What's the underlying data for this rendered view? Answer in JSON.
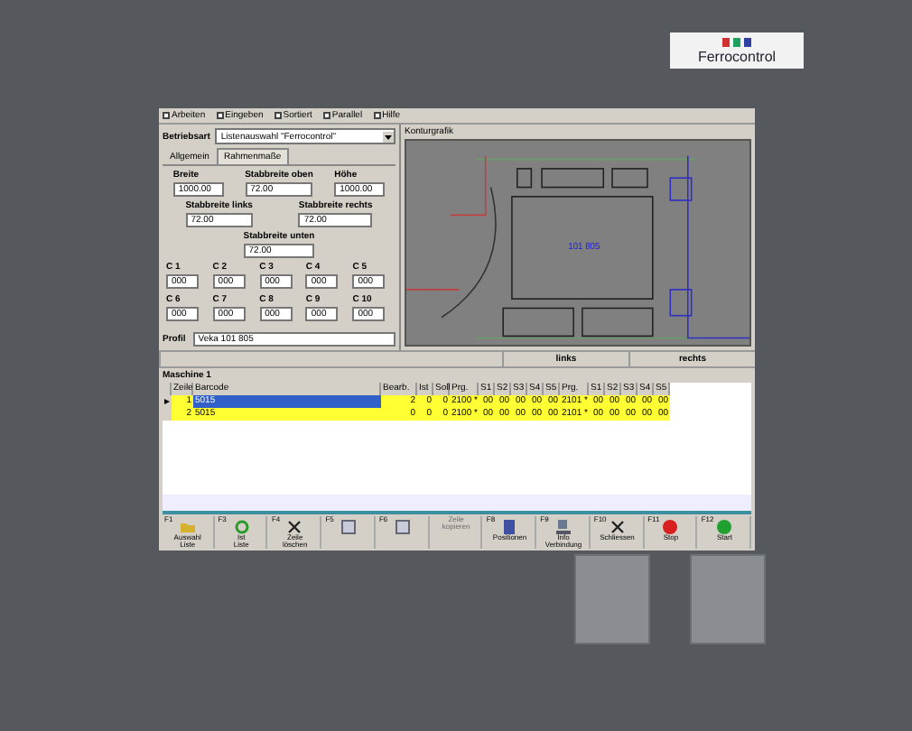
{
  "logo": {
    "text": "Ferrocontrol"
  },
  "menu": [
    {
      "label": "Arbeiten"
    },
    {
      "label": "Eingeben"
    },
    {
      "label": "Sortiert"
    },
    {
      "label": "Parallel"
    },
    {
      "label": "Hilfe"
    }
  ],
  "mode": {
    "label": "Betriebsart",
    "value": "Listenauswahl \"Ferrocontrol\""
  },
  "tabs": [
    {
      "label": "Allgemein",
      "selected": false
    },
    {
      "label": "Rahmenmaße",
      "selected": true
    }
  ],
  "field_rows": [
    [
      {
        "label": "Breite",
        "value": "1000.00"
      },
      {
        "label": "Stabbreite oben",
        "value": "72.00"
      },
      {
        "label": "Höhe",
        "value": "1000.00"
      }
    ],
    [
      {
        "label": "Stabbreite links",
        "value": "72.00"
      },
      {
        "label": "Stabbreite rechts",
        "value": "72.00"
      }
    ],
    [
      {
        "label": "Stabbreite unten",
        "value": "72.00"
      }
    ]
  ],
  "c_fields": [
    {
      "label": "C 1",
      "value": "000"
    },
    {
      "label": "C 2",
      "value": "000"
    },
    {
      "label": "C 3",
      "value": "000"
    },
    {
      "label": "C 4",
      "value": "000"
    },
    {
      "label": "C 5",
      "value": "000"
    },
    {
      "label": "C 6",
      "value": "000"
    },
    {
      "label": "C 7",
      "value": "000"
    },
    {
      "label": "C 8",
      "value": "000"
    },
    {
      "label": "C 9",
      "value": "000"
    },
    {
      "label": "C 10",
      "value": "000"
    }
  ],
  "profile": {
    "label": "Profil",
    "value": "Veka 101 805"
  },
  "contour": {
    "title": "Konturgrafik",
    "label": "101 805"
  },
  "sides": [
    "links",
    "rechts"
  ],
  "machine": {
    "title": "Maschine 1",
    "columns": [
      "Zeile",
      "Barcode",
      "Bearb.",
      "Ist",
      "Soll",
      "Prg.",
      "S1",
      "S2",
      "S3",
      "S4",
      "S5",
      "Prg.",
      "S1",
      "S2",
      "S3",
      "S4",
      "S5"
    ],
    "rows": [
      {
        "selected": true,
        "cells": [
          "1",
          "5015",
          "2",
          "0",
          "0",
          "2100 *",
          "00",
          "00",
          "00",
          "00",
          "00",
          "2101 *",
          "00",
          "00",
          "00",
          "00",
          "00"
        ]
      },
      {
        "selected": false,
        "cells": [
          "2",
          "5015",
          "0",
          "0",
          "0",
          "2100 *",
          "00",
          "00",
          "00",
          "00",
          "00",
          "2101 *",
          "00",
          "00",
          "00",
          "00",
          "00"
        ]
      }
    ]
  },
  "fkeys": [
    {
      "key": "F1",
      "label": "Auswahl\nListe",
      "kind": "folder",
      "disabled": false
    },
    {
      "key": "F3",
      "label": "Ist\nListe",
      "kind": "refresh",
      "disabled": false
    },
    {
      "key": "F4",
      "label": "Zeile\nlöschen",
      "kind": "cross",
      "disabled": false
    },
    {
      "key": "F5",
      "kind": "window",
      "disabled": false
    },
    {
      "key": "F6",
      "kind": "window",
      "disabled": false
    },
    {
      "label": "Zeile\nkopieren",
      "kind": "none",
      "disabled": true
    },
    {
      "key": "F8",
      "label": "Positionen",
      "kind": "document",
      "disabled": false
    },
    {
      "key": "F9",
      "label": "Info\nVerbindung",
      "kind": "network",
      "disabled": false
    },
    {
      "key": "F10",
      "label": "Schliessen",
      "kind": "cross",
      "disabled": false
    },
    {
      "key": "F11",
      "label": "Stop",
      "kind": "stop",
      "disabled": false
    },
    {
      "key": "F12",
      "label": "Start",
      "kind": "start",
      "disabled": false
    }
  ]
}
